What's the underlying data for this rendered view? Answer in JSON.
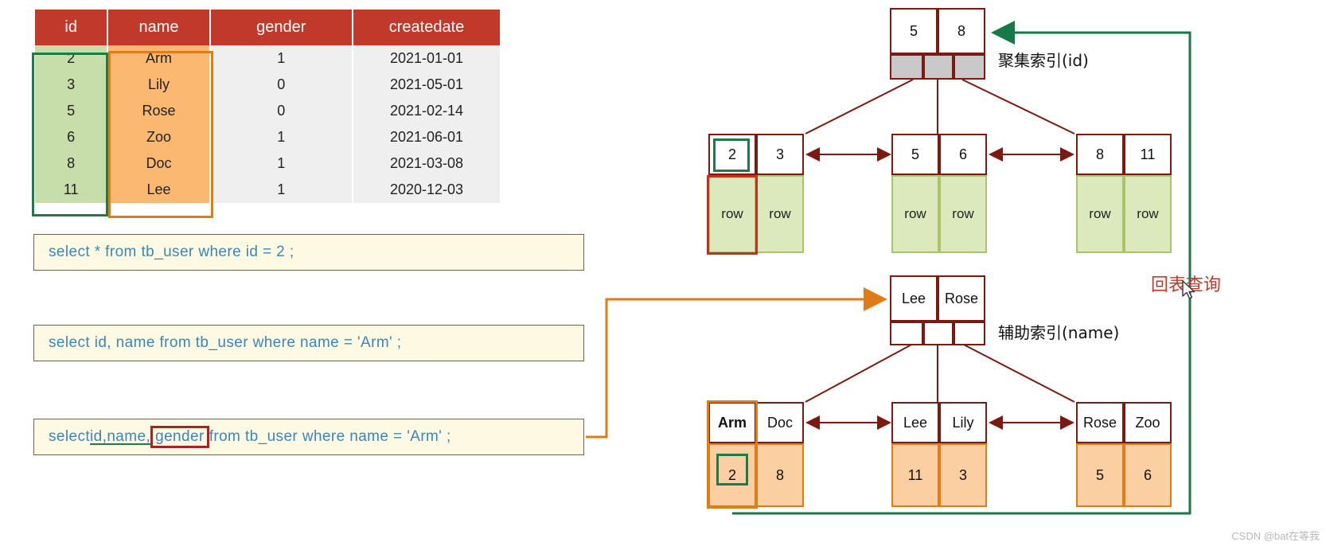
{
  "table": {
    "columns": [
      "id",
      "name",
      "gender",
      "createdate"
    ],
    "rows": [
      {
        "id": "2",
        "name": "Arm",
        "gender": "1",
        "createdate": "2021-01-01"
      },
      {
        "id": "3",
        "name": "Lily",
        "gender": "0",
        "createdate": "2021-05-01"
      },
      {
        "id": "5",
        "name": "Rose",
        "gender": "0",
        "createdate": "2021-02-14"
      },
      {
        "id": "6",
        "name": "Zoo",
        "gender": "1",
        "createdate": "2021-06-01"
      },
      {
        "id": "8",
        "name": "Doc",
        "gender": "1",
        "createdate": "2021-03-08"
      },
      {
        "id": "11",
        "name": "Lee",
        "gender": "1",
        "createdate": "2020-12-03"
      }
    ]
  },
  "sql": {
    "stmt1": "select * from  tb_user  where  id  =  2 ;",
    "stmt2": "select  id, name  from  tb_user  where  name = 'Arm' ;",
    "stmt3": {
      "prefix": "select ",
      "underlined": "id,name,",
      "boxed": "gender",
      "suffix": " from  tb_user  where  name = 'Arm' ;"
    }
  },
  "clustered_index": {
    "caption": "聚集索引(id)",
    "root_keys": [
      "5",
      "8"
    ],
    "leaves": [
      {
        "keys": [
          "2",
          "3"
        ],
        "values": [
          "row",
          "row"
        ]
      },
      {
        "keys": [
          "5",
          "6"
        ],
        "values": [
          "row",
          "row"
        ]
      },
      {
        "keys": [
          "8",
          "11"
        ],
        "values": [
          "row",
          "row"
        ]
      }
    ]
  },
  "secondary_index": {
    "caption": "辅助索引(name)",
    "root_keys": [
      "Lee",
      "Rose"
    ],
    "leaves": [
      {
        "keys": [
          "Arm",
          "Doc"
        ],
        "values": [
          "2",
          "8"
        ]
      },
      {
        "keys": [
          "Lee",
          "Lily"
        ],
        "values": [
          "11",
          "3"
        ]
      },
      {
        "keys": [
          "Rose",
          "Zoo"
        ],
        "values": [
          "5",
          "6"
        ]
      }
    ]
  },
  "annotations": {
    "back_to_table": "回表查询"
  },
  "watermark": "CSDN @bat在等我",
  "colors": {
    "header_red": "#c0392b",
    "id_green": "#c7ddaa",
    "name_orange": "#fbb871",
    "sql_bg": "#fdf9e3",
    "sql_text": "#3a86b5",
    "node_border": "#7b1a12",
    "green_arrow": "#147a46",
    "orange_arrow": "#e07b18"
  }
}
